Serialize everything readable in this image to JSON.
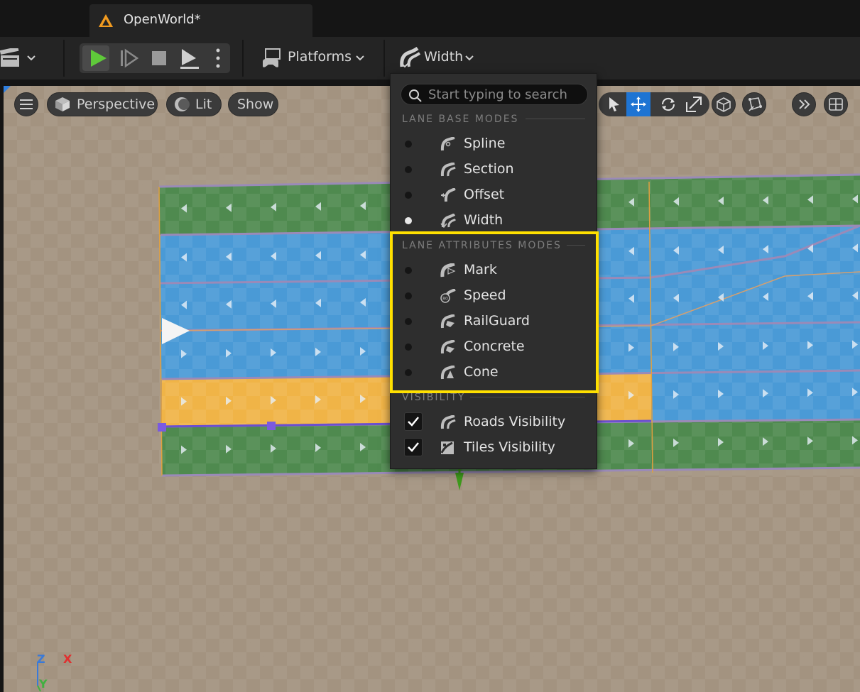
{
  "window": {
    "tab_title": "OpenWorld*"
  },
  "toolbar": {
    "platforms_label": "Platforms",
    "mode_label": "Width"
  },
  "viewport": {
    "perspective_label": "Perspective",
    "lit_label": "Lit",
    "show_label": "Show",
    "axis": {
      "z": "Z",
      "x": "X",
      "y": "Y"
    }
  },
  "menu": {
    "search_placeholder": "Start typing to search",
    "base_header": "LANE BASE MODES",
    "base_items": [
      {
        "label": "Spline",
        "selected": false
      },
      {
        "label": "Section",
        "selected": false
      },
      {
        "label": "Offset",
        "selected": false
      },
      {
        "label": "Width",
        "selected": true
      }
    ],
    "attr_header": "LANE ATTRIBUTES MODES",
    "attr_items": [
      {
        "label": "Mark",
        "selected": false
      },
      {
        "label": "Speed",
        "selected": false
      },
      {
        "label": "RailGuard",
        "selected": false
      },
      {
        "label": "Concrete",
        "selected": false
      },
      {
        "label": "Cone",
        "selected": false
      }
    ],
    "vis_header": "VISIBILITY",
    "vis_items": [
      {
        "label": "Roads Visibility",
        "checked": true
      },
      {
        "label": "Tiles Visibility",
        "checked": true
      }
    ]
  },
  "colors": {
    "highlight": "#ffe000",
    "lane_green": "#4f8a4f",
    "lane_blue": "#4a9ad6",
    "lane_yellow": "#f0b447",
    "active_tool": "#1e74d3",
    "play_green": "#5fc93a"
  }
}
